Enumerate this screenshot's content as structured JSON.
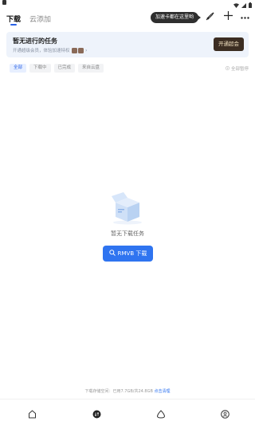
{
  "status_bar": {},
  "tabs": {
    "download": "下载",
    "cloud_add": "云添加"
  },
  "header": {
    "tooltip": "加速卡都在这里哟"
  },
  "banner": {
    "title": "暂无进行的任务",
    "subtitle": "开通超级会员，体验加速特权",
    "button": "开通超会"
  },
  "filters": {
    "items": [
      "全部",
      "下载中",
      "已完成",
      "来自云盘"
    ],
    "active_index": 0,
    "sort_label": "全部暂停"
  },
  "empty": {
    "text": "暂无下载任务",
    "button": "RMVB 下载"
  },
  "footer": {
    "storage_text": "下载存储空间：已用7.7GB/共24.8GB",
    "link": "点击清理"
  },
  "colors": {
    "accent": "#2f74f0",
    "banner_bg": "#eef3fb",
    "banner_btn": "#3c2d22"
  }
}
